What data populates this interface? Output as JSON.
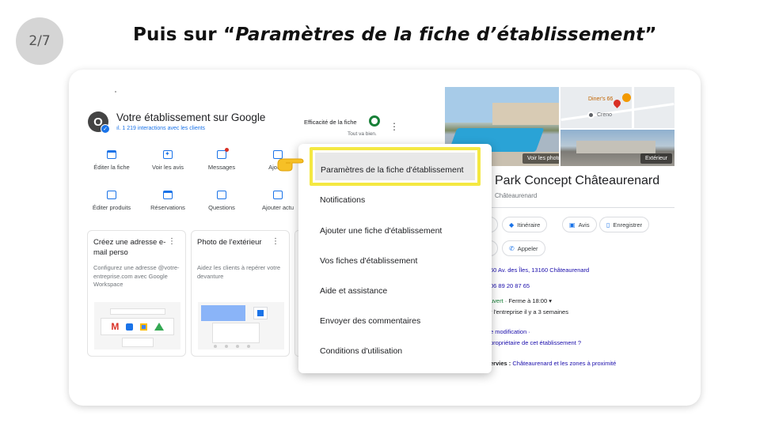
{
  "slide": {
    "step": "2/7",
    "title_prefix": "Puis sur “",
    "title_em": "Paramètres de la fiche d’établissement",
    "title_suffix": "”"
  },
  "gbp": {
    "avatar_letter": "O",
    "title": "Votre établissement sur Google",
    "stats": "ıl. 1 219 interactions avec les clients",
    "efficacite_label": "Efficacité de la fiche",
    "efficacite_status": "Tout va bien.",
    "actions_row1": [
      {
        "icon": "storefront-icon",
        "label": "Éditer la fiche"
      },
      {
        "icon": "star-review-icon",
        "label": "Voir les avis"
      },
      {
        "icon": "message-icon",
        "label": "Messages"
      },
      {
        "icon": "photo-icon",
        "label": "Ajouter"
      }
    ],
    "actions_row2": [
      {
        "icon": "shopping-bag-icon",
        "label": "Éditer produits"
      },
      {
        "icon": "calendar-icon",
        "label": "Réservations"
      },
      {
        "icon": "question-icon",
        "label": "Questions"
      },
      {
        "icon": "add-post-icon",
        "label": "Ajouter actu"
      }
    ],
    "tiles": [
      {
        "title": "Créez une adresse e-mail perso",
        "desc": "Configurez une adresse @votre-entreprise.com avec Google Workspace"
      },
      {
        "title": "Photo de l'extérieur",
        "desc": "Aidez les clients à repérer votre devanture"
      }
    ]
  },
  "menu": {
    "items": [
      "Paramètres de la fiche d'établissement",
      "Notifications",
      "Ajouter une fiche d'établissement",
      "Vos fiches d'établissement",
      "Aide et assistance",
      "Envoyer des commentaires",
      "Conditions d'utilisation"
    ],
    "highlight_color": "#f4e842"
  },
  "knowledge_panel": {
    "photo_tag_left": "Voir les photos",
    "photo_tag_right": "Extérieur",
    "map_label_1": "Diner's 66",
    "map_label_2": "Creno",
    "title": "Park Concept Châteaurenard",
    "city": "Châteaurenard",
    "chips_row1": [
      "Itinéraire",
      "Avis",
      "Enregistrer"
    ],
    "chips_row2": [
      "Appeler"
    ],
    "address": "60 Av. des Îles, 13160 Châteaurenard",
    "phone": "06 89 20 87 65",
    "hours_open": "uvert",
    "hours_rest": " · Ferme à 18:00 ▾",
    "update": "r l'entreprise il y a 3 semaines",
    "suggest": "e modification ·",
    "owner": "propriétaire de cet établissement ?",
    "served_label": "ervies : ",
    "served_value": "Châteaurenard et les zones à proximité"
  },
  "colors": {
    "accent_blue": "#1a73e8",
    "green_ok": "#188038",
    "highlight_yellow": "#f4e842"
  }
}
